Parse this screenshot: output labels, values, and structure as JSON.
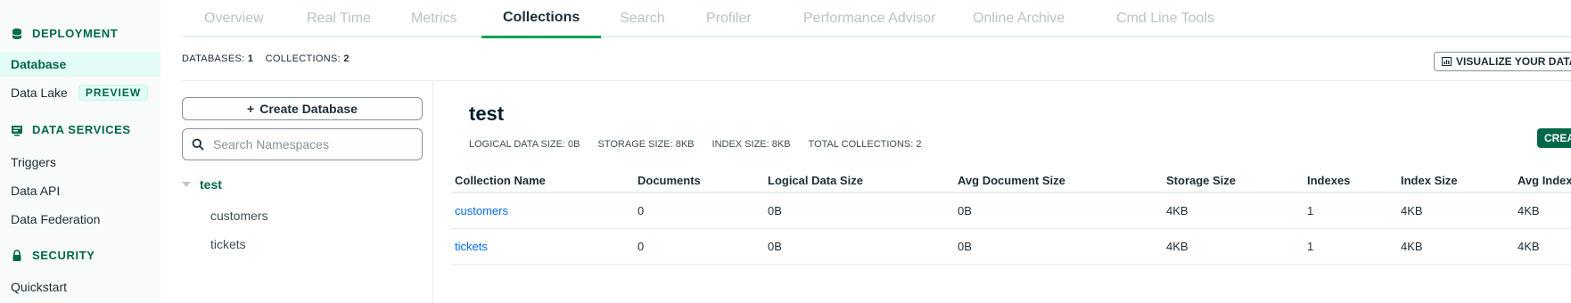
{
  "sidebar": {
    "sections": [
      {
        "label": "DEPLOYMENT",
        "icon": "database-icon"
      },
      {
        "label": "DATA SERVICES",
        "icon": "data-services-icon"
      },
      {
        "label": "SECURITY",
        "icon": "lock-icon"
      }
    ],
    "items": [
      {
        "label": "Database",
        "active": true
      },
      {
        "label": "Data Lake",
        "badge": "PREVIEW"
      },
      {
        "label": "Triggers"
      },
      {
        "label": "Data API"
      },
      {
        "label": "Data Federation"
      },
      {
        "label": "Quickstart"
      }
    ]
  },
  "tabs": [
    "Overview",
    "Real Time",
    "Metrics",
    "Collections",
    "Search",
    "Profiler",
    "Performance Advisor",
    "Online Archive",
    "Cmd Line Tools"
  ],
  "active_tab": "Collections",
  "summary": {
    "databases_label": "DATABASES:",
    "databases_value": "1",
    "collections_label": "COLLECTIONS:",
    "collections_value": "2",
    "visualize_button": "VISUALIZE YOUR DATA"
  },
  "left_panel": {
    "create_database": "Create Database",
    "search_placeholder": "Search Namespaces",
    "database": "test",
    "collections": [
      "customers",
      "tickets"
    ]
  },
  "main": {
    "title": "test",
    "stats": {
      "logical": "LOGICAL DATA SIZE: 0B",
      "storage": "STORAGE SIZE: 8KB",
      "index": "INDEX SIZE: 8KB",
      "total": "TOTAL COLLECTIONS: 2"
    },
    "create_button": "CREATE",
    "table": {
      "headers": [
        "Collection Name",
        "Documents",
        "Logical Data Size",
        "Avg Document Size",
        "Storage Size",
        "Indexes",
        "Index Size",
        "Avg Index Size"
      ],
      "rows": [
        [
          "customers",
          "0",
          "0B",
          "0B",
          "4KB",
          "1",
          "4KB",
          "4KB"
        ],
        [
          "tickets",
          "0",
          "0B",
          "0B",
          "4KB",
          "1",
          "4KB",
          "4KB"
        ]
      ]
    }
  },
  "colors": {
    "brand_green": "#00684a",
    "accent_green": "#00a35c",
    "link_blue": "#016bf8"
  }
}
